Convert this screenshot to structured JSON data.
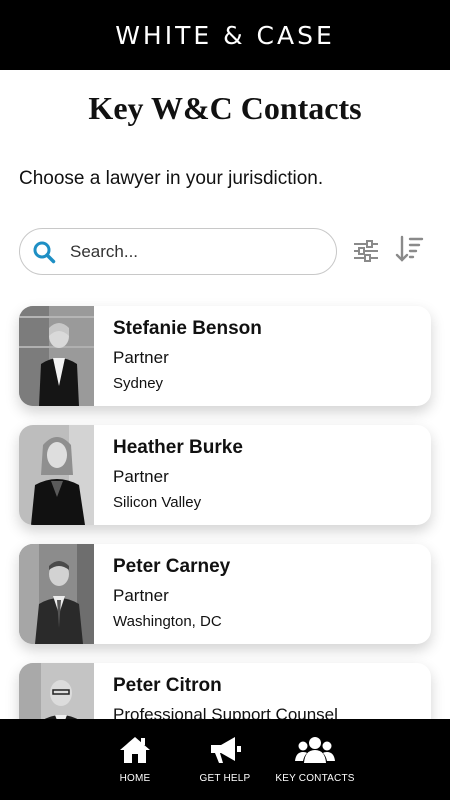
{
  "header": {
    "brand": "WHITE & CASE"
  },
  "page": {
    "title": "Key W&C Contacts",
    "subtitle": "Choose a lawyer in your jurisdiction."
  },
  "search": {
    "placeholder": "Search...",
    "value": ""
  },
  "toolbar": {
    "filter_icon": "sliders-icon",
    "sort_icon": "sort-descending-icon"
  },
  "contacts": [
    {
      "name": "Stefanie Benson",
      "title": "Partner",
      "office": "Sydney"
    },
    {
      "name": "Heather Burke",
      "title": "Partner",
      "office": "Silicon Valley"
    },
    {
      "name": "Peter Carney",
      "title": "Partner",
      "office": "Washington, DC"
    },
    {
      "name": "Peter Citron",
      "title": "Professional Support Counsel",
      "office": ""
    }
  ],
  "nav": [
    {
      "label": "HOME",
      "icon": "home-icon"
    },
    {
      "label": "GET HELP",
      "icon": "megaphone-icon"
    },
    {
      "label": "KEY CONTACTS",
      "icon": "users-icon"
    }
  ]
}
